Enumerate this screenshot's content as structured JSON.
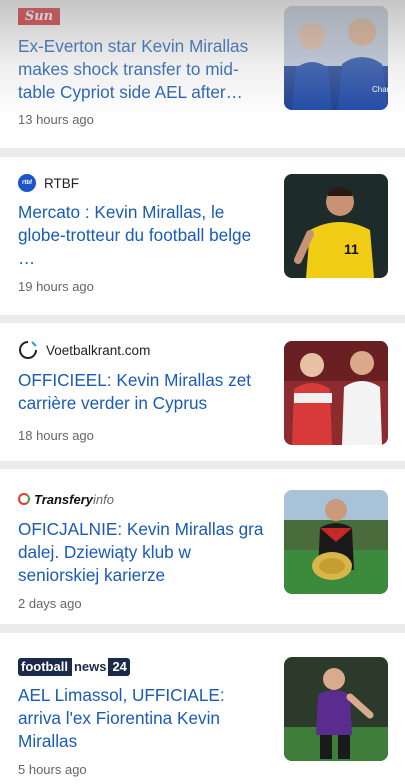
{
  "articles": [
    {
      "source": "The Sun",
      "logo_text": "Sun",
      "headline": "Ex-Everton star Kevin Mirallas makes shock transfer to mid-table Cypriot side AEL after…",
      "time": "13 hours ago",
      "thumb_icon": "player-photo-icon"
    },
    {
      "source": "RTBF",
      "logo_text": "rtbf",
      "headline": "Mercato : Kevin Mirallas, le globe-trotteur du football belge …",
      "time": "19 hours ago",
      "thumb_icon": "player-photo-icon"
    },
    {
      "source": "Voetbalkrant.com",
      "headline": "OFFICIEEL: Kevin Mirallas zet carrière verder in Cyprus",
      "time": "18 hours ago",
      "thumb_icon": "player-photo-icon"
    },
    {
      "source": "Transferyinfo",
      "logo_main": "Transfery",
      "logo_sub": "info",
      "headline": "OFICJALNIE: Kevin Mirallas gra dalej. Dziewiąty klub w seniorskiej karierze",
      "time": "2 days ago",
      "thumb_icon": "player-photo-icon"
    },
    {
      "source": "football news 24",
      "logo_a": "football",
      "logo_b": "news",
      "logo_c": "24",
      "headline": "AEL Limassol, UFFICIALE: arriva l'ex Fiorentina Kevin Mirallas",
      "time": "5 hours ago",
      "thumb_icon": "player-photo-icon"
    }
  ],
  "colors": {
    "headline": "#1a5bb8",
    "background": "#ececec",
    "card": "#ffffff"
  }
}
